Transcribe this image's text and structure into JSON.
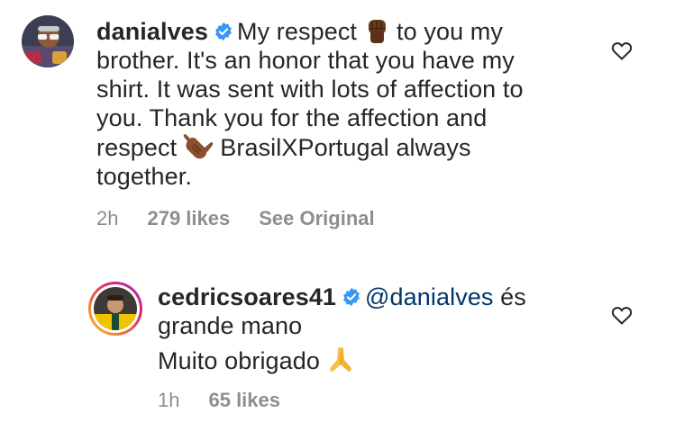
{
  "comments": [
    {
      "username": "danialves",
      "text_1": "My respect",
      "text_2": "to you my",
      "line_2": "brother. It's an honor that you have my",
      "line_3": "shirt. It was sent with lots of affection to",
      "line_4": "you. Thank you for the affection and",
      "line_5a": "respect",
      "line_5b": "BrasilXPortugal always",
      "line_6": "together.",
      "time": "2h",
      "likes": "279 likes",
      "see_original": "See Original",
      "emoji_1": "raised-fist-icon",
      "emoji_2": "call-me-hand-icon"
    },
    {
      "username": "cedricsoares41",
      "mention": "@danialves",
      "text_1": "és",
      "line_2": "grande mano",
      "line_3": "Muito obrigado",
      "time": "1h",
      "likes": "65 likes",
      "emoji_1": "folded-hands-icon"
    }
  ],
  "colors": {
    "text": "#262626",
    "meta": "#8e8e8e",
    "mention": "#00376b",
    "verified": "#3897f0"
  }
}
